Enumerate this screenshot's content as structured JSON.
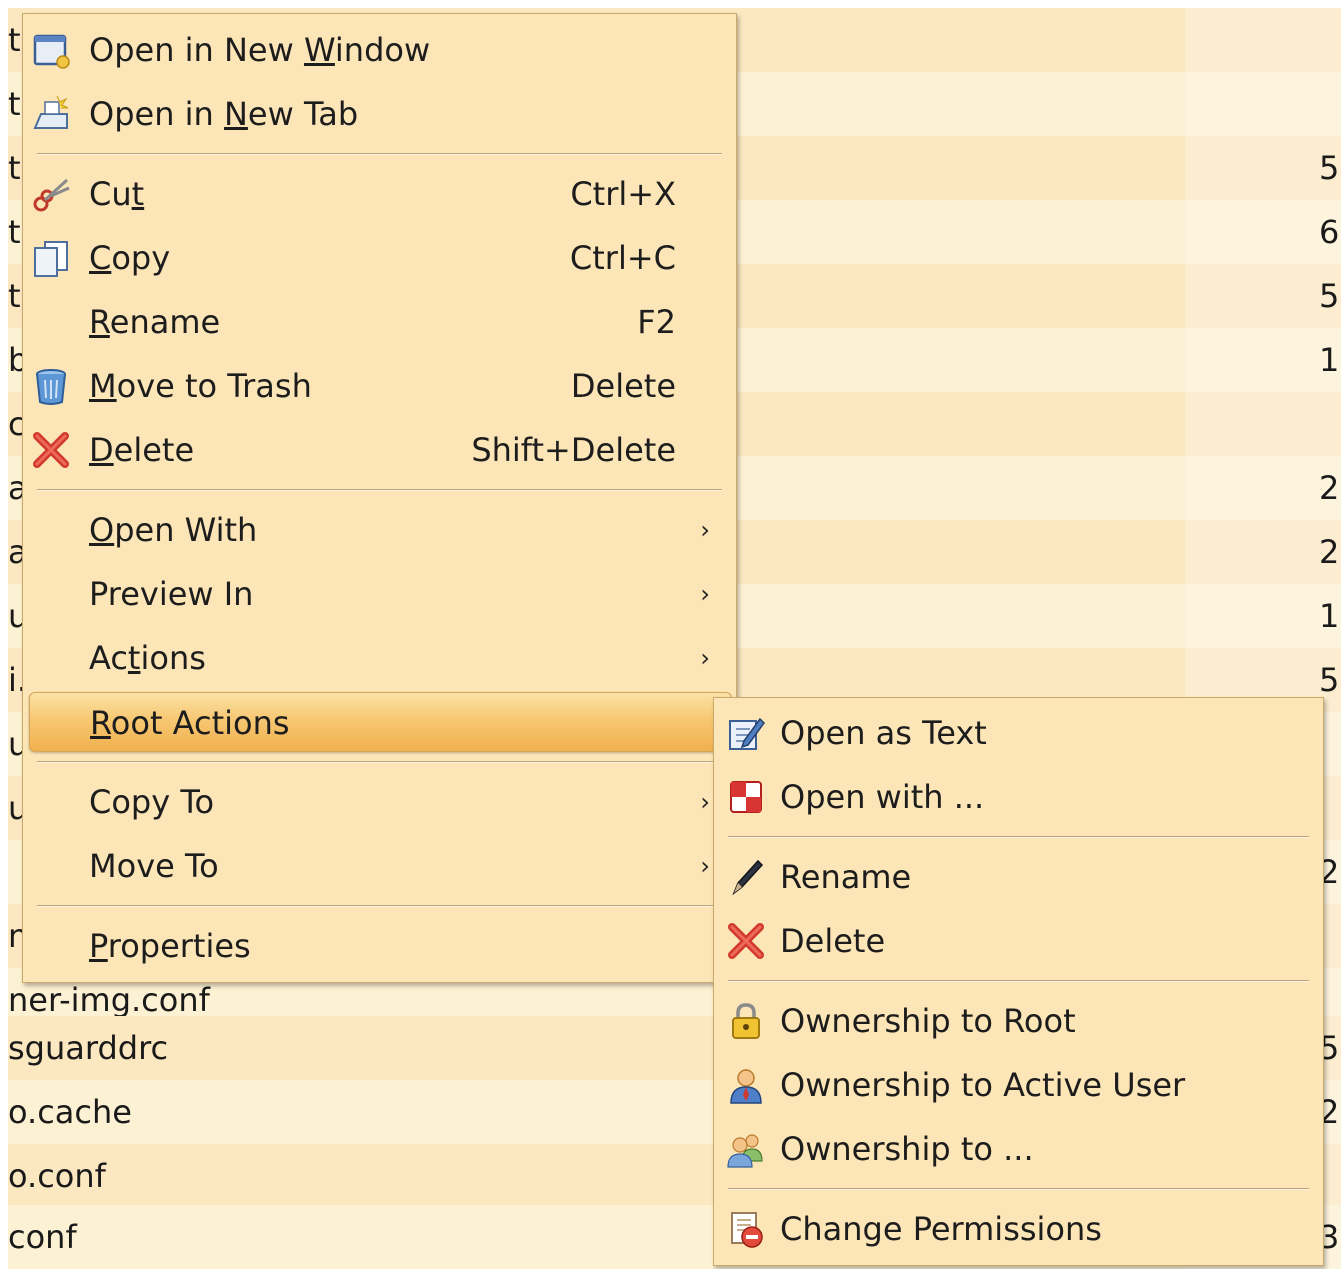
{
  "file_list": {
    "rows": [
      {
        "name": "t",
        "size": ""
      },
      {
        "name": "t",
        "size": ""
      },
      {
        "name": "t",
        "size": "5"
      },
      {
        "name": "t",
        "size": "6"
      },
      {
        "name": "t",
        "size": "5"
      },
      {
        "name": "b",
        "size": "1"
      },
      {
        "name": "c",
        "size": ""
      },
      {
        "name": "a",
        "size": "2"
      },
      {
        "name": "a",
        "size": "2"
      },
      {
        "name": "u",
        "size": "1"
      },
      {
        "name": "i.",
        "size": "5"
      },
      {
        "name": "u",
        "size": ""
      },
      {
        "name": "u",
        "size": ""
      },
      {
        "name": "",
        "size": "2"
      },
      {
        "name": "n",
        "size": ""
      },
      {
        "name": "ner-img.conf",
        "size": ""
      },
      {
        "name": "sguarddrc",
        "size": "5"
      },
      {
        "name": "o.cache",
        "size": "2"
      },
      {
        "name": "o.conf",
        "size": ""
      },
      {
        "name": "conf",
        "size": "3"
      }
    ]
  },
  "main_menu": {
    "items": [
      {
        "label": "Open in New Window",
        "mnemonic_index": 12,
        "shortcut": "",
        "icon": "window-icon"
      },
      {
        "label": "Open in New Tab",
        "mnemonic_index": 8,
        "shortcut": "",
        "icon": "tab-icon"
      },
      {
        "label": "Cut",
        "mnemonic_index": 2,
        "shortcut": "Ctrl+X",
        "icon": "scissors-icon"
      },
      {
        "label": "Copy",
        "mnemonic_index": 0,
        "shortcut": "Ctrl+C",
        "icon": "copy-icon"
      },
      {
        "label": "Rename",
        "mnemonic_index": 0,
        "shortcut": "F2",
        "icon": ""
      },
      {
        "label": "Move to Trash",
        "mnemonic_index": 0,
        "shortcut": "Delete",
        "icon": "trash-icon"
      },
      {
        "label": "Delete",
        "mnemonic_index": 0,
        "shortcut": "Shift+Delete",
        "icon": "delete-x-icon"
      },
      {
        "label": "Open With",
        "mnemonic_index": 0,
        "submenu": true
      },
      {
        "label": "Preview In",
        "submenu": true
      },
      {
        "label": "Actions",
        "mnemonic_index": 2,
        "submenu": true
      },
      {
        "label": "Root Actions",
        "mnemonic_index": 0,
        "submenu": true,
        "highlighted": true
      },
      {
        "label": "Copy To",
        "submenu": true
      },
      {
        "label": "Move To",
        "submenu": true
      },
      {
        "label": "Properties",
        "mnemonic_index": 0
      }
    ],
    "arrow": "›"
  },
  "sub_menu": {
    "items": [
      {
        "label": "Open as Text",
        "icon": "edit-text-icon"
      },
      {
        "label": "Open with ...",
        "icon": "open-with-icon"
      },
      {
        "label": "Rename",
        "icon": "pen-icon"
      },
      {
        "label": "Delete",
        "icon": "delete-x-icon"
      },
      {
        "label": "Ownership to Root",
        "icon": "lock-icon"
      },
      {
        "label": "Ownership to Active User",
        "icon": "user-icon"
      },
      {
        "label": "Ownership to ...",
        "icon": "users-icon"
      },
      {
        "label": "Change Permissions",
        "icon": "permissions-icon"
      }
    ]
  },
  "colors": {
    "menu_bg": "#fce6b7",
    "highlight": "#f0b04f",
    "row_even": "#fdf1d3",
    "row_odd": "#fbe7c0"
  }
}
